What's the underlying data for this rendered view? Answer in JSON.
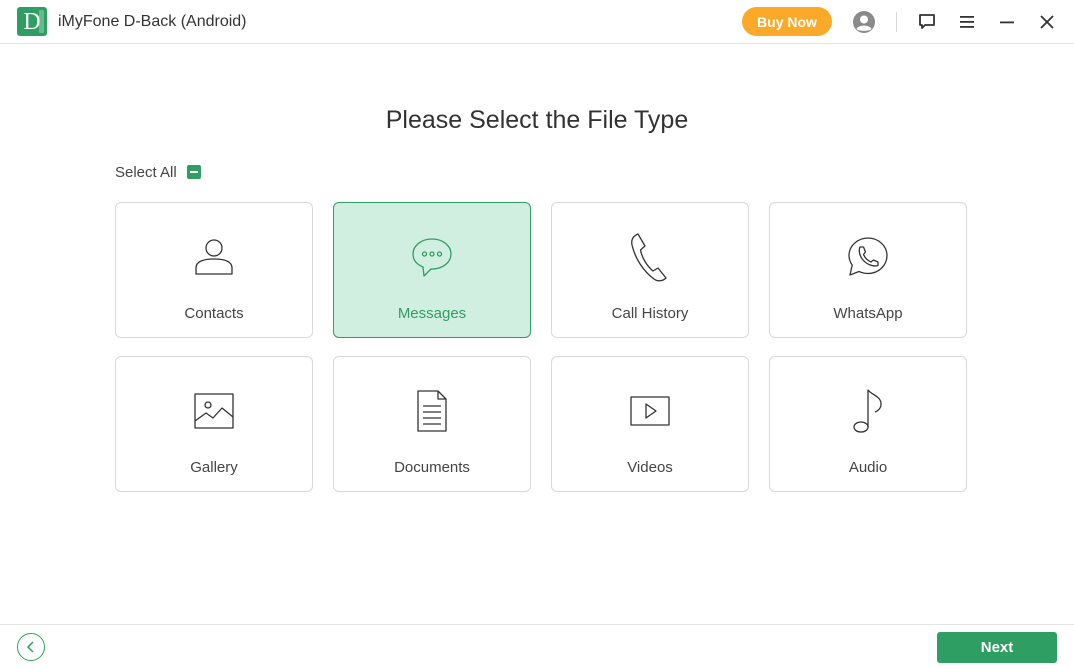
{
  "app": {
    "logo_letter": "D",
    "title": "iMyFone D-Back (Android)",
    "buy_now_label": "Buy Now",
    "icons": [
      "user-icon",
      "feedback-icon",
      "menu-icon",
      "minimize-icon",
      "close-icon"
    ]
  },
  "main": {
    "page_title": "Please Select the File Type",
    "select_all_label": "Select All",
    "select_all_state": "partial",
    "file_types": [
      {
        "label": "Contacts",
        "icon": "contacts-icon",
        "selected": false
      },
      {
        "label": "Messages",
        "icon": "messages-icon",
        "selected": true
      },
      {
        "label": "Call History",
        "icon": "phone-icon",
        "selected": false
      },
      {
        "label": "WhatsApp",
        "icon": "whatsapp-icon",
        "selected": false
      },
      {
        "label": "Gallery",
        "icon": "gallery-icon",
        "selected": false
      },
      {
        "label": "Documents",
        "icon": "document-icon",
        "selected": false
      },
      {
        "label": "Videos",
        "icon": "video-icon",
        "selected": false
      },
      {
        "label": "Audio",
        "icon": "music-note-icon",
        "selected": false
      }
    ]
  },
  "footer": {
    "back_icon": "chevron-left-icon",
    "next_label": "Next"
  },
  "colors": {
    "accent": "#2e9e63",
    "selected_bg": "#d1efe0",
    "buy_now": "#fba928",
    "border": "#d9d9d9"
  }
}
